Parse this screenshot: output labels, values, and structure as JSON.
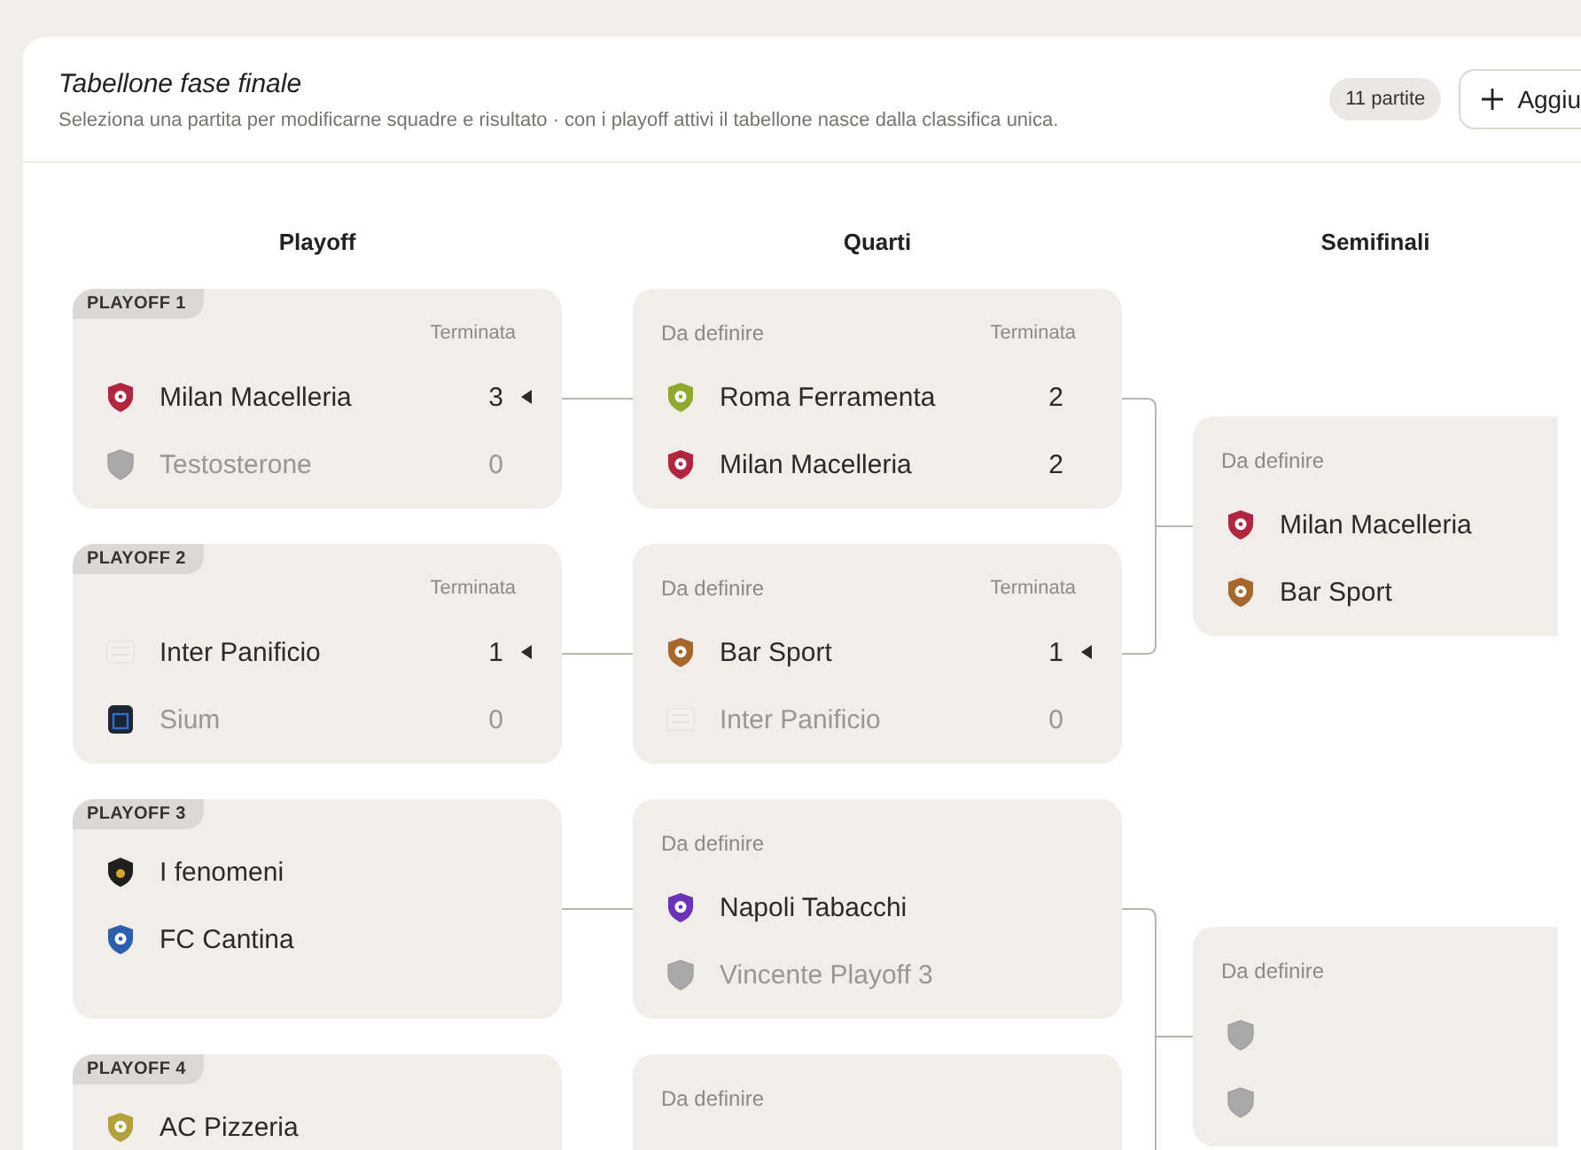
{
  "header": {
    "title": "Tabellone fase finale",
    "subtitle": "Seleziona una partita per modificarne squadre e risultato · con i playoff attivi il tabellone nasce dalla classifica unica.",
    "count": "11 partite",
    "add_button": "Aggiu"
  },
  "columns": [
    {
      "title": "Playoff",
      "matches": [
        {
          "tag": "PLAYOFF 1",
          "status": "Terminata",
          "teams": [
            {
              "name": "Milan Macelleria",
              "score": "3",
              "winner": true,
              "muted": false,
              "kind": "shield",
              "color": "#b3243f"
            },
            {
              "name": "Testosterone",
              "score": "0",
              "winner": false,
              "muted": true,
              "kind": "empty",
              "color": "#a9a9a9"
            }
          ]
        },
        {
          "tag": "PLAYOFF 2",
          "status": "Terminata",
          "teams": [
            {
              "name": "Inter Panificio",
              "score": "1",
              "winner": true,
              "muted": false,
              "kind": "light",
              "color": "#f3f1ed"
            },
            {
              "name": "Sium",
              "score": "0",
              "winner": false,
              "muted": true,
              "kind": "dark",
              "color": "#1d2533"
            }
          ]
        },
        {
          "tag": "PLAYOFF 3",
          "teams": [
            {
              "name": "I fenomeni",
              "muted": false,
              "kind": "black",
              "color": "#1f1f1f"
            },
            {
              "name": "FC Cantina",
              "muted": false,
              "kind": "shield",
              "color": "#2a5fb0"
            }
          ]
        },
        {
          "tag": "PLAYOFF 4",
          "teams": [
            {
              "name": "AC Pizzeria",
              "muted": false,
              "kind": "shield",
              "color": "#b3a23c"
            }
          ]
        }
      ]
    },
    {
      "title": "Quarti",
      "matches": [
        {
          "label": "Da definire",
          "status": "Terminata",
          "teams": [
            {
              "name": "Roma Ferramenta",
              "score": "2",
              "winner": false,
              "muted": false,
              "kind": "shield",
              "color": "#8faa2b"
            },
            {
              "name": "Milan Macelleria",
              "score": "2",
              "winner": false,
              "muted": false,
              "kind": "shield",
              "color": "#b3243f"
            }
          ]
        },
        {
          "label": "Da definire",
          "status": "Terminata",
          "teams": [
            {
              "name": "Bar Sport",
              "score": "1",
              "winner": true,
              "muted": false,
              "kind": "shield",
              "color": "#a8672a"
            },
            {
              "name": "Inter Panificio",
              "score": "0",
              "winner": false,
              "muted": true,
              "kind": "light",
              "color": "#f3f1ed"
            }
          ]
        },
        {
          "label": "Da definire",
          "teams": [
            {
              "name": "Napoli Tabacchi",
              "muted": false,
              "kind": "shield",
              "color": "#6a33b8"
            },
            {
              "name": "Vincente Playoff 3",
              "muted": true,
              "kind": "empty",
              "color": "#a9a9a9"
            }
          ]
        },
        {
          "label": "Da definire"
        }
      ]
    },
    {
      "title": "Semifinali",
      "matches": [
        {
          "label": "Da definire",
          "teams": [
            {
              "name": "Milan Macelleria",
              "muted": false,
              "kind": "shield",
              "color": "#b3243f"
            },
            {
              "name": "Bar Sport",
              "muted": false,
              "kind": "shield",
              "color": "#a8672a"
            }
          ]
        },
        {
          "label": "Da definire",
          "teams": [
            {
              "kind": "empty",
              "color": "#a9a9a9"
            },
            {
              "kind": "empty",
              "color": "#a9a9a9"
            }
          ]
        }
      ]
    }
  ]
}
